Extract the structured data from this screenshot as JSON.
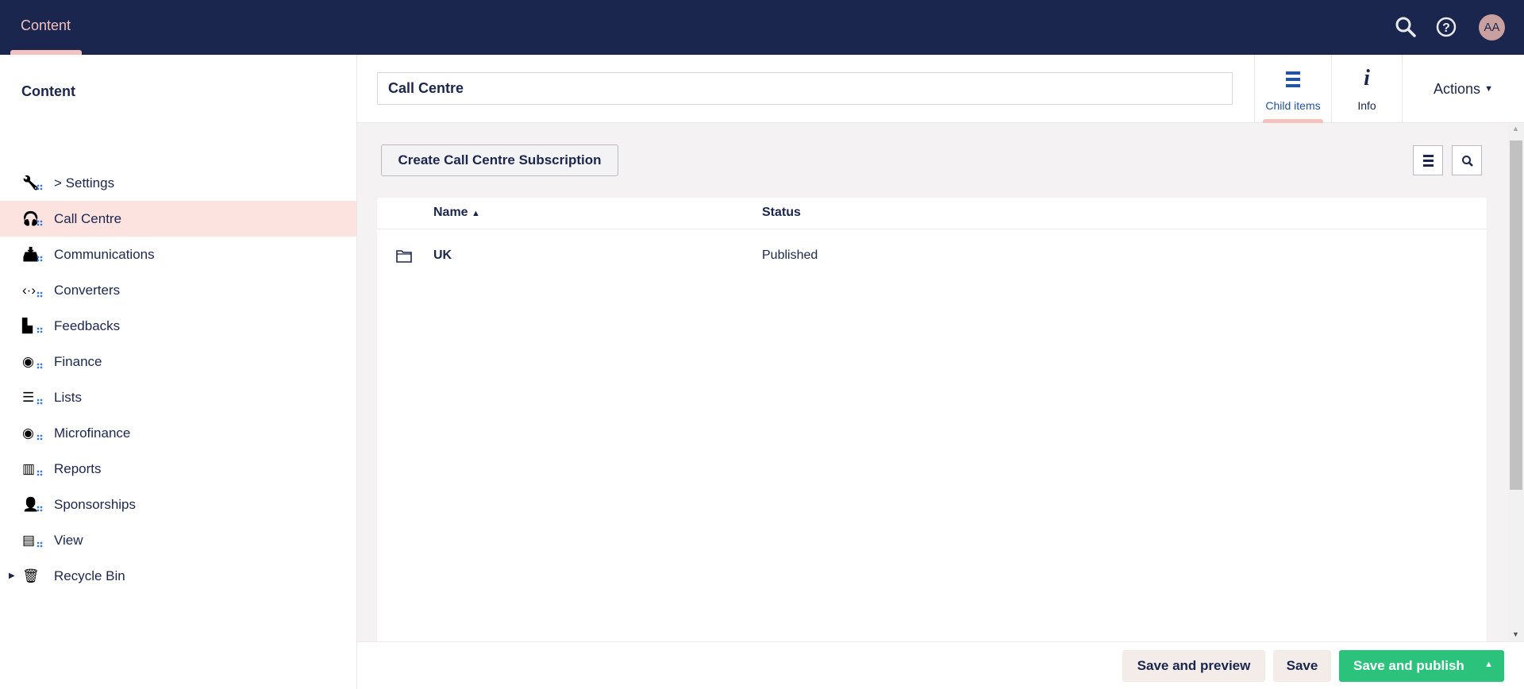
{
  "topbar": {
    "section": "Content",
    "avatar_initials": "AA",
    "icons": [
      "search-icon",
      "help-icon"
    ]
  },
  "sidebar": {
    "title": "Content",
    "items": [
      {
        "label": "> Settings",
        "icon": "wrench-icon"
      },
      {
        "label": "Call Centre",
        "icon": "headset-icon",
        "active": true
      },
      {
        "label": "Communications",
        "icon": "inbox-icon"
      },
      {
        "label": "Converters",
        "icon": "code-icon"
      },
      {
        "label": "Feedbacks",
        "icon": "feedback-icon"
      },
      {
        "label": "Finance",
        "icon": "coins-icon"
      },
      {
        "label": "Lists",
        "icon": "list-icon"
      },
      {
        "label": "Microfinance",
        "icon": "coins-icon"
      },
      {
        "label": "Reports",
        "icon": "books-icon"
      },
      {
        "label": "Sponsorships",
        "icon": "users-icon"
      },
      {
        "label": "View",
        "icon": "document-icon"
      },
      {
        "label": "Recycle Bin",
        "icon": "trash-icon"
      }
    ]
  },
  "editor": {
    "name_value": "Call Centre",
    "tabs": [
      {
        "label": "Child items",
        "active": true
      },
      {
        "label": "Info"
      }
    ],
    "actions_label": "Actions"
  },
  "listview": {
    "create_label": "Create Call Centre Subscription",
    "columns": [
      "Name",
      "Status"
    ],
    "sort": "Name ascending",
    "rows": [
      {
        "name": "UK",
        "status": "Published",
        "icon": "folder-icon"
      }
    ]
  },
  "footer": {
    "save_preview": "Save and preview",
    "save": "Save",
    "save_publish": "Save and publish"
  },
  "colors": {
    "header": "#1b264f",
    "accent": "#f5c1bc",
    "active_bg": "#fde3e0",
    "publish": "#2bc37c",
    "tab_active": "#2152a3"
  }
}
